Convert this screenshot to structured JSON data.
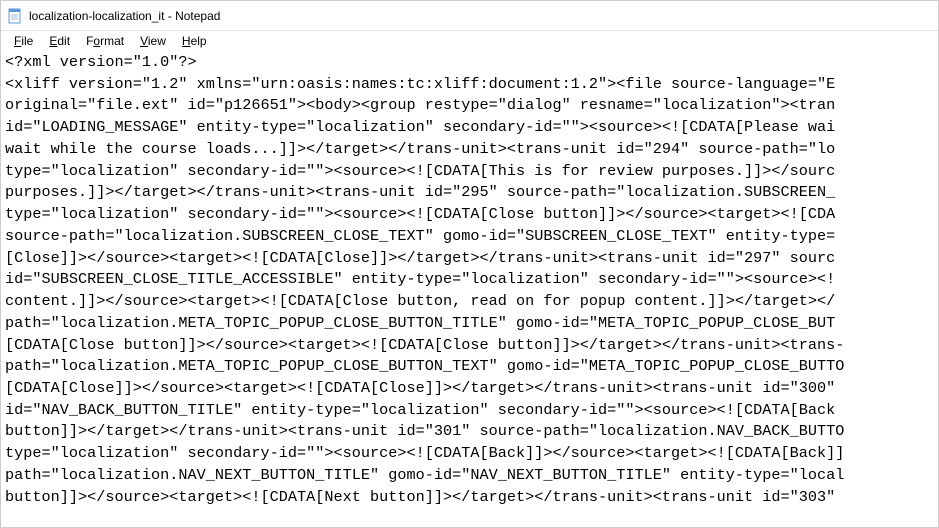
{
  "window": {
    "title": "localization-localization_it - Notepad"
  },
  "menu": {
    "file": "File",
    "edit": "Edit",
    "format": "Format",
    "view": "View",
    "help": "Help"
  },
  "content": {
    "text": "<?xml version=\"1.0\"?>\n<xliff version=\"1.2\" xmlns=\"urn:oasis:names:tc:xliff:document:1.2\"><file source-language=\"E\noriginal=\"file.ext\" id=\"p126651\"><body><group restype=\"dialog\" resname=\"localization\"><tran\nid=\"LOADING_MESSAGE\" entity-type=\"localization\" secondary-id=\"\"><source><![CDATA[Please wai\nwait while the course loads...]]></target></trans-unit><trans-unit id=\"294\" source-path=\"lo\ntype=\"localization\" secondary-id=\"\"><source><![CDATA[This is for review purposes.]]></sourc\npurposes.]]></target></trans-unit><trans-unit id=\"295\" source-path=\"localization.SUBSCREEN_\ntype=\"localization\" secondary-id=\"\"><source><![CDATA[Close button]]></source><target><![CDA\nsource-path=\"localization.SUBSCREEN_CLOSE_TEXT\" gomo-id=\"SUBSCREEN_CLOSE_TEXT\" entity-type=\n[Close]]></source><target><![CDATA[Close]]></target></trans-unit><trans-unit id=\"297\" sourc\nid=\"SUBSCREEN_CLOSE_TITLE_ACCESSIBLE\" entity-type=\"localization\" secondary-id=\"\"><source><!\ncontent.]]></source><target><![CDATA[Close button, read on for popup content.]]></target></\npath=\"localization.META_TOPIC_POPUP_CLOSE_BUTTON_TITLE\" gomo-id=\"META_TOPIC_POPUP_CLOSE_BUT\n[CDATA[Close button]]></source><target><![CDATA[Close button]]></target></trans-unit><trans-\npath=\"localization.META_TOPIC_POPUP_CLOSE_BUTTON_TEXT\" gomo-id=\"META_TOPIC_POPUP_CLOSE_BUTTO\n[CDATA[Close]]></source><target><![CDATA[Close]]></target></trans-unit><trans-unit id=\"300\" \nid=\"NAV_BACK_BUTTON_TITLE\" entity-type=\"localization\" secondary-id=\"\"><source><![CDATA[Back \nbutton]]></target></trans-unit><trans-unit id=\"301\" source-path=\"localization.NAV_BACK_BUTTO\ntype=\"localization\" secondary-id=\"\"><source><![CDATA[Back]]></source><target><![CDATA[Back]]\npath=\"localization.NAV_NEXT_BUTTON_TITLE\" gomo-id=\"NAV_NEXT_BUTTON_TITLE\" entity-type=\"local\nbutton]]></source><target><![CDATA[Next button]]></target></trans-unit><trans-unit id=\"303\" "
  }
}
